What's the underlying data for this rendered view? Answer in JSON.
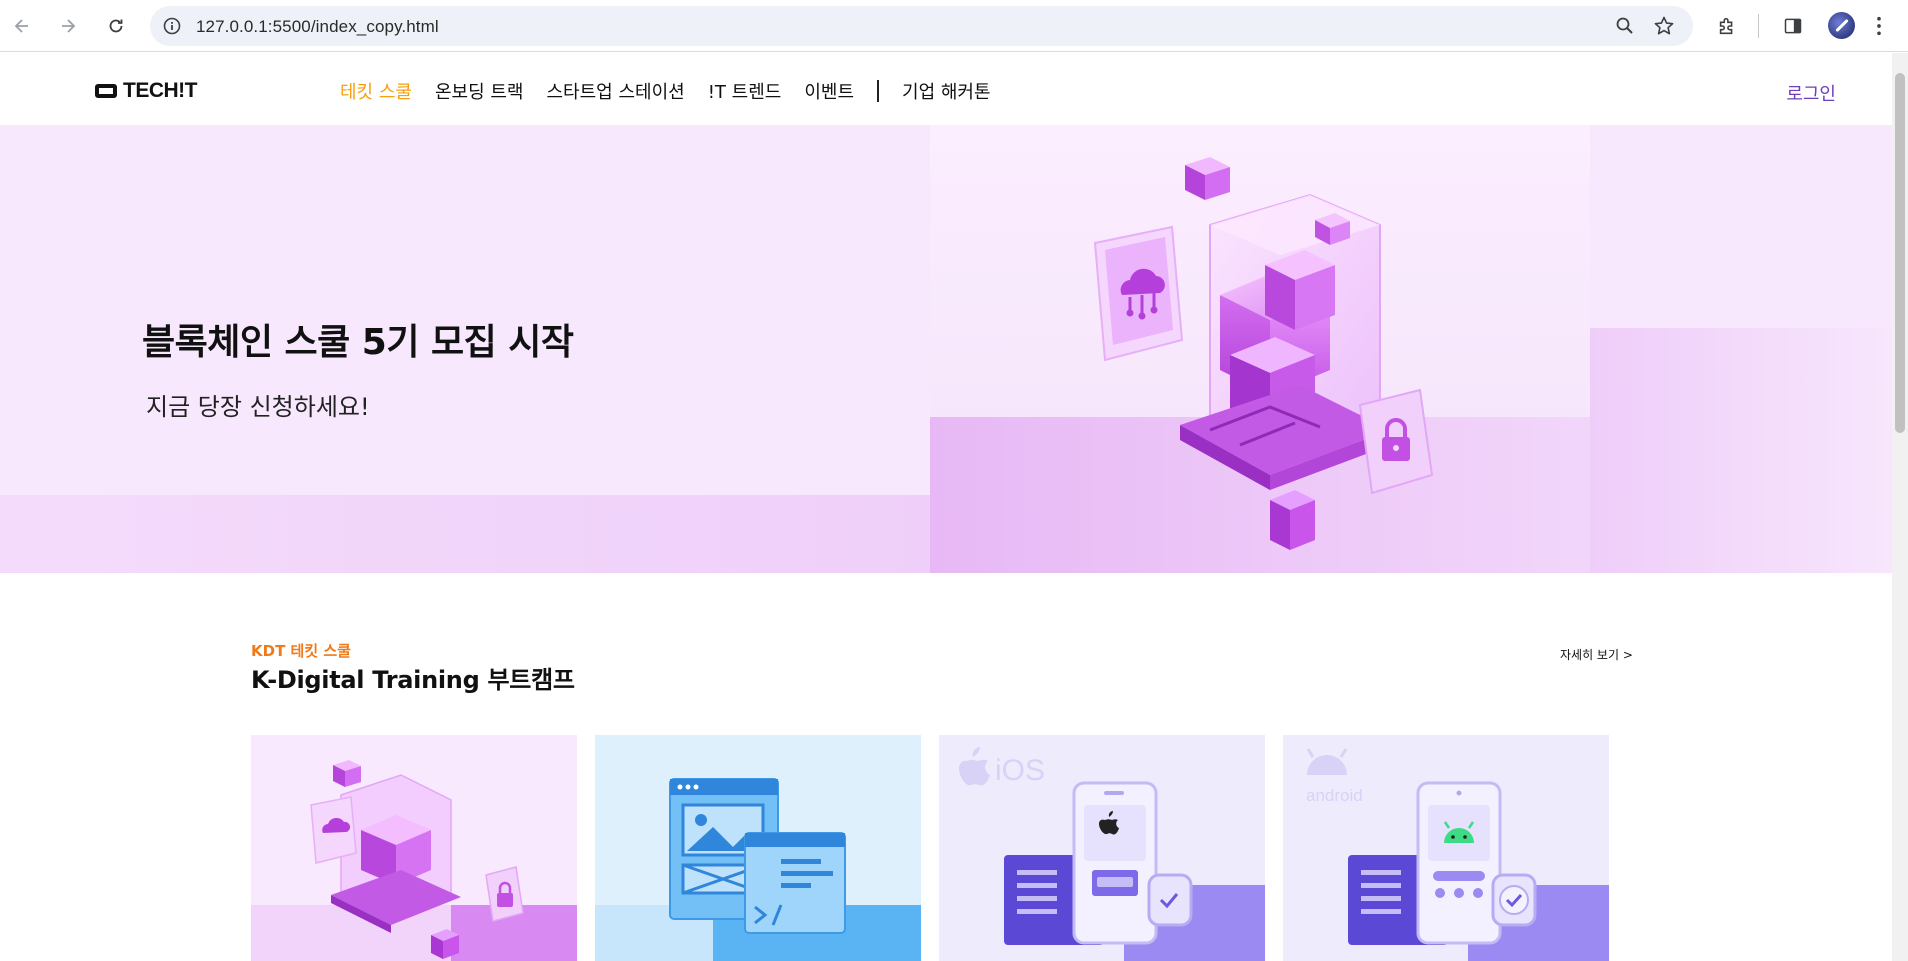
{
  "browser": {
    "url": "127.0.0.1:5500/index_copy.html",
    "icons": [
      "back-arrow-icon",
      "forward-arrow-icon",
      "reload-icon",
      "site-info-icon",
      "zoom-icon",
      "bookmark-star-icon",
      "extensions-icon",
      "side-panel-icon",
      "profile-avatar",
      "kebab-menu-icon"
    ]
  },
  "header": {
    "logo": "TECH!T",
    "nav": [
      {
        "label": "테킷 스쿨",
        "active": true
      },
      {
        "label": "온보딩 트랙",
        "active": false
      },
      {
        "label": "스타트업 스테이션",
        "active": false
      },
      {
        "label": "!T 트렌드",
        "active": false
      },
      {
        "label": "이벤트",
        "active": false
      },
      {
        "label": "기업 해커톤",
        "active": false
      }
    ],
    "login": "로그인"
  },
  "hero": {
    "title": "블록체인 스쿨 5기 모집 시작",
    "subtitle": "지금 당장 신청하세요!"
  },
  "section": {
    "kicker": "KDT 테킷 스쿨",
    "title": "K-Digital Training 부트캠프",
    "more": "자세히 보기 >"
  },
  "cards": [
    {
      "icon": "blockchain-cube-illustration"
    },
    {
      "icon": "web-browser-illustration"
    },
    {
      "icon": "ios-phone-illustration",
      "label": "iOS"
    },
    {
      "icon": "android-phone-illustration",
      "label": "android"
    }
  ],
  "colors": {
    "accent_orange": "#f5a012",
    "kicker_orange": "#ef7a1a",
    "login_purple": "#6b3fb8",
    "hero_bg": "#f7e8fd"
  }
}
